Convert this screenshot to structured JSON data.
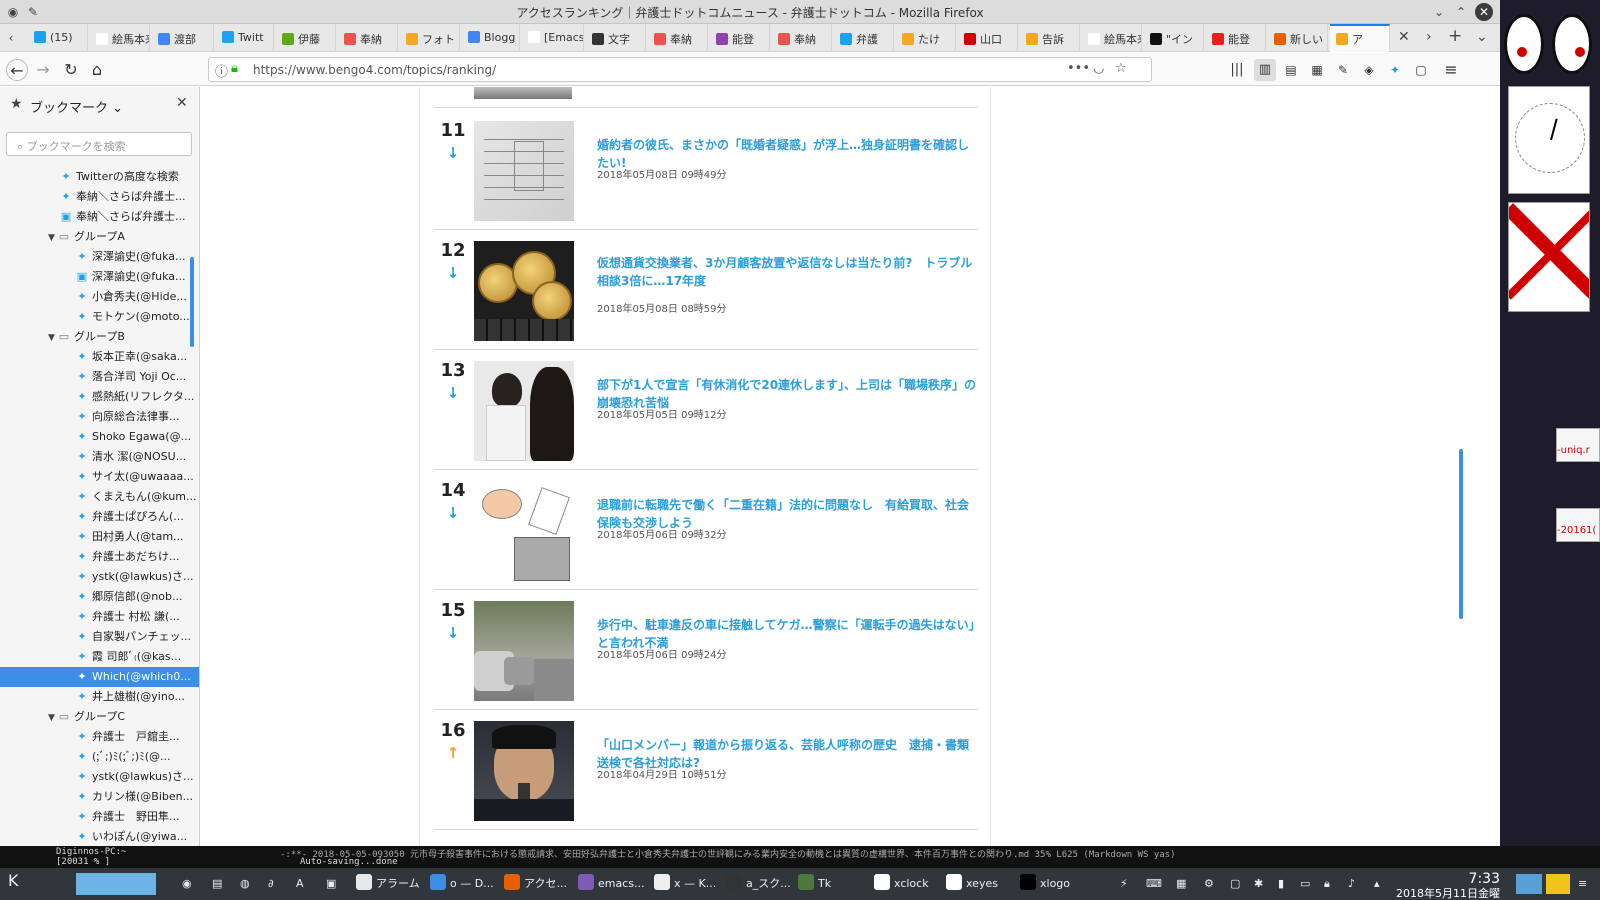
{
  "window": {
    "title": "アクセスランキング｜弁護士ドットコムニュース - 弁護士ドットコム - Mozilla Firefox"
  },
  "tabs": [
    {
      "label": "(15)",
      "color": "#1da1f2"
    },
    {
      "label": "絵馬本来",
      "color": "#ffffff"
    },
    {
      "label": "渡部",
      "color": "#4285f4"
    },
    {
      "label": "Twitt",
      "color": "#1da1f2"
    },
    {
      "label": "伊藤",
      "color": "#60a917"
    },
    {
      "label": "奉納",
      "color": "#e8554e"
    },
    {
      "label": "フォト",
      "color": "#f5a623"
    },
    {
      "label": "Blogg",
      "color": "#4285f4"
    },
    {
      "label": "[Emacs]",
      "color": "#ffffff"
    },
    {
      "label": "文字",
      "color": "#333333"
    },
    {
      "label": "奉納",
      "color": "#e8554e"
    },
    {
      "label": "能登",
      "color": "#8e44ad"
    },
    {
      "label": "奉納",
      "color": "#e8554e"
    },
    {
      "label": "弁護",
      "color": "#1da1f2"
    },
    {
      "label": "たけ",
      "color": "#f5a623"
    },
    {
      "label": "山口",
      "color": "#d10000"
    },
    {
      "label": "告訴",
      "color": "#f5a623"
    },
    {
      "label": "絵馬本来",
      "color": "#ffffff"
    },
    {
      "label": "\"イン",
      "color": "#111111"
    },
    {
      "label": "能登",
      "color": "#e62117"
    },
    {
      "label": "新しい",
      "color": "#e66000"
    },
    {
      "label": "ア",
      "color": "#f5a623"
    }
  ],
  "nav": {
    "url": "https://www.bengo4.com/topics/ranking/"
  },
  "sidebar": {
    "title": "ブックマーク",
    "search_placeholder": "ブックマークを検索",
    "items": [
      {
        "label": "Twitterの高度な検索",
        "type": "tw",
        "indent": 2
      },
      {
        "label": "奉納＼さらば弁護士...",
        "type": "tw",
        "indent": 2
      },
      {
        "label": "奉納＼さらば弁護士...",
        "type": "t",
        "indent": 2
      },
      {
        "label": "グループA",
        "type": "folder",
        "indent": 1
      },
      {
        "label": "深澤諭史(@fuka...",
        "type": "tw",
        "indent": 3
      },
      {
        "label": "深澤諭史(@fuka...",
        "type": "t",
        "indent": 3
      },
      {
        "label": "小倉秀夫(@Hide...",
        "type": "tw",
        "indent": 3
      },
      {
        "label": "モトケン(@moto...",
        "type": "tw",
        "indent": 3
      },
      {
        "label": "グループB",
        "type": "folder",
        "indent": 1
      },
      {
        "label": "坂本正幸(@saka...",
        "type": "tw",
        "indent": 3
      },
      {
        "label": "落合洋司 Yoji Oc...",
        "type": "tw",
        "indent": 3
      },
      {
        "label": "感熱紙(リフレクタ...",
        "type": "tw",
        "indent": 3
      },
      {
        "label": "向原総合法律事...",
        "type": "tw",
        "indent": 3
      },
      {
        "label": "Shoko Egawa(@...",
        "type": "tw",
        "indent": 3
      },
      {
        "label": "清水 潔(@NOSU...",
        "type": "tw",
        "indent": 3
      },
      {
        "label": "サイ太(@uwaaaa...",
        "type": "tw",
        "indent": 3
      },
      {
        "label": "くまえもん(@kum...",
        "type": "tw",
        "indent": 3
      },
      {
        "label": "弁護士ぱぴろん(...",
        "type": "tw",
        "indent": 3
      },
      {
        "label": "田村勇人(@tam...",
        "type": "tw",
        "indent": 3
      },
      {
        "label": "弁護士あだちけ...",
        "type": "tw",
        "indent": 3
      },
      {
        "label": "ystk(@lawkus)さ...",
        "type": "tw",
        "indent": 3
      },
      {
        "label": "郷原信郎(@nob...",
        "type": "tw",
        "indent": 3
      },
      {
        "label": "弁護士 村松 謙(...",
        "type": "tw",
        "indent": 3
      },
      {
        "label": "自家製パンチェッ...",
        "type": "tw",
        "indent": 3
      },
      {
        "label": "霞 司郎ﾞ₍(@kas...",
        "type": "tw",
        "indent": 3
      },
      {
        "label": "Which(@which0...",
        "type": "tw",
        "indent": 3,
        "selected": true
      },
      {
        "label": "井上雄樹(@yino...",
        "type": "tw",
        "indent": 3
      },
      {
        "label": "グループC",
        "type": "folder",
        "indent": 1
      },
      {
        "label": "弁護士　戸舘圭...",
        "type": "tw",
        "indent": 3
      },
      {
        "label": "(;ﾞ;)ﾐ(;ﾞ;)ﾐ(@...",
        "type": "tw",
        "indent": 3
      },
      {
        "label": "ystk(@lawkus)さ...",
        "type": "tw",
        "indent": 3
      },
      {
        "label": "カリン様(@Biben...",
        "type": "tw",
        "indent": 3
      },
      {
        "label": "弁護士　野田隼...",
        "type": "tw",
        "indent": 3
      },
      {
        "label": "いわぽん(@yiwa...",
        "type": "tw",
        "indent": 3
      }
    ]
  },
  "ranking": [
    {
      "rank": "11",
      "trend": "down",
      "thumb": "doc",
      "title": "婚約者の彼氏、まさかの「既婚者疑惑」が浮上…独身証明書を確認したい!",
      "date": "2018年05月08日 09時49分"
    },
    {
      "rank": "12",
      "trend": "down",
      "thumb": "coin",
      "title": "仮想通貨交換業者、3か月顧客放置や返信なしは当たり前?　トラブル相談3倍に…17年度",
      "date": "2018年05月08日 08時59分"
    },
    {
      "rank": "13",
      "trend": "down",
      "thumb": "women",
      "title": "部下が1人で宣言「有休消化で20連休します」、上司は「職場秩序」の崩壊恐れ苦悩",
      "date": "2018年05月05日 09時12分"
    },
    {
      "rank": "14",
      "trend": "down",
      "thumb": "cartoon",
      "title": "退職前に転職先で働く「二重在籍」法的に問題なし　有給買取、社会保険も交渉しよう",
      "date": "2018年05月06日 09時32分"
    },
    {
      "rank": "15",
      "trend": "down",
      "thumb": "street",
      "title": "歩行中、駐車違反の車に接触してケガ…警察に「運転手の過失はない」と言われ不満",
      "date": "2018年05月06日 09時24分"
    },
    {
      "rank": "16",
      "trend": "up",
      "thumb": "man",
      "title": "「山口メンバー」報道から振り返る、芸能人呼称の歴史　逮捕・書類送検で各社対応は?",
      "date": "2018年04月29日 10時51分"
    }
  ],
  "gadgets": {
    "snip1": "-uniq.r",
    "snip2": "-20161("
  },
  "terminal": {
    "prompt_host": "Diginnos-PC:~",
    "prompt_line": "[20031  % ]",
    "emacs_status": "-:**-  2018-05-05-093050 元市母子殺害事件における懲戒請求、安田好弘弁護士と小倉秀夫弁護士の世評観にみる業内安全の動機とは異質の虚構世界、本件百万事件との関わり.md    35% L625   (Markdown WS yas)",
    "minibuffer": "Auto-saving...done"
  },
  "taskbar": {
    "items": [
      {
        "label": "アラーム",
        "color": "#e8e8e8"
      },
      {
        "label": "o — D...",
        "color": "#3d8ee6"
      },
      {
        "label": "アクセ...",
        "color": "#e66000"
      },
      {
        "label": "emacs...",
        "color": "#7f5ab6"
      },
      {
        "label": "x — K...",
        "color": "#eeeeee"
      },
      {
        "label": "a_スク...",
        "color": "#333333"
      },
      {
        "label": "Tk",
        "color": "#4d7a3c"
      },
      {
        "label": "xclock",
        "color": "#ffffff"
      },
      {
        "label": "xeyes",
        "color": "#ffffff"
      },
      {
        "label": "xlogo",
        "color": "#000000"
      }
    ],
    "time": "7:33",
    "date": "2018年5月11日金曜日"
  }
}
